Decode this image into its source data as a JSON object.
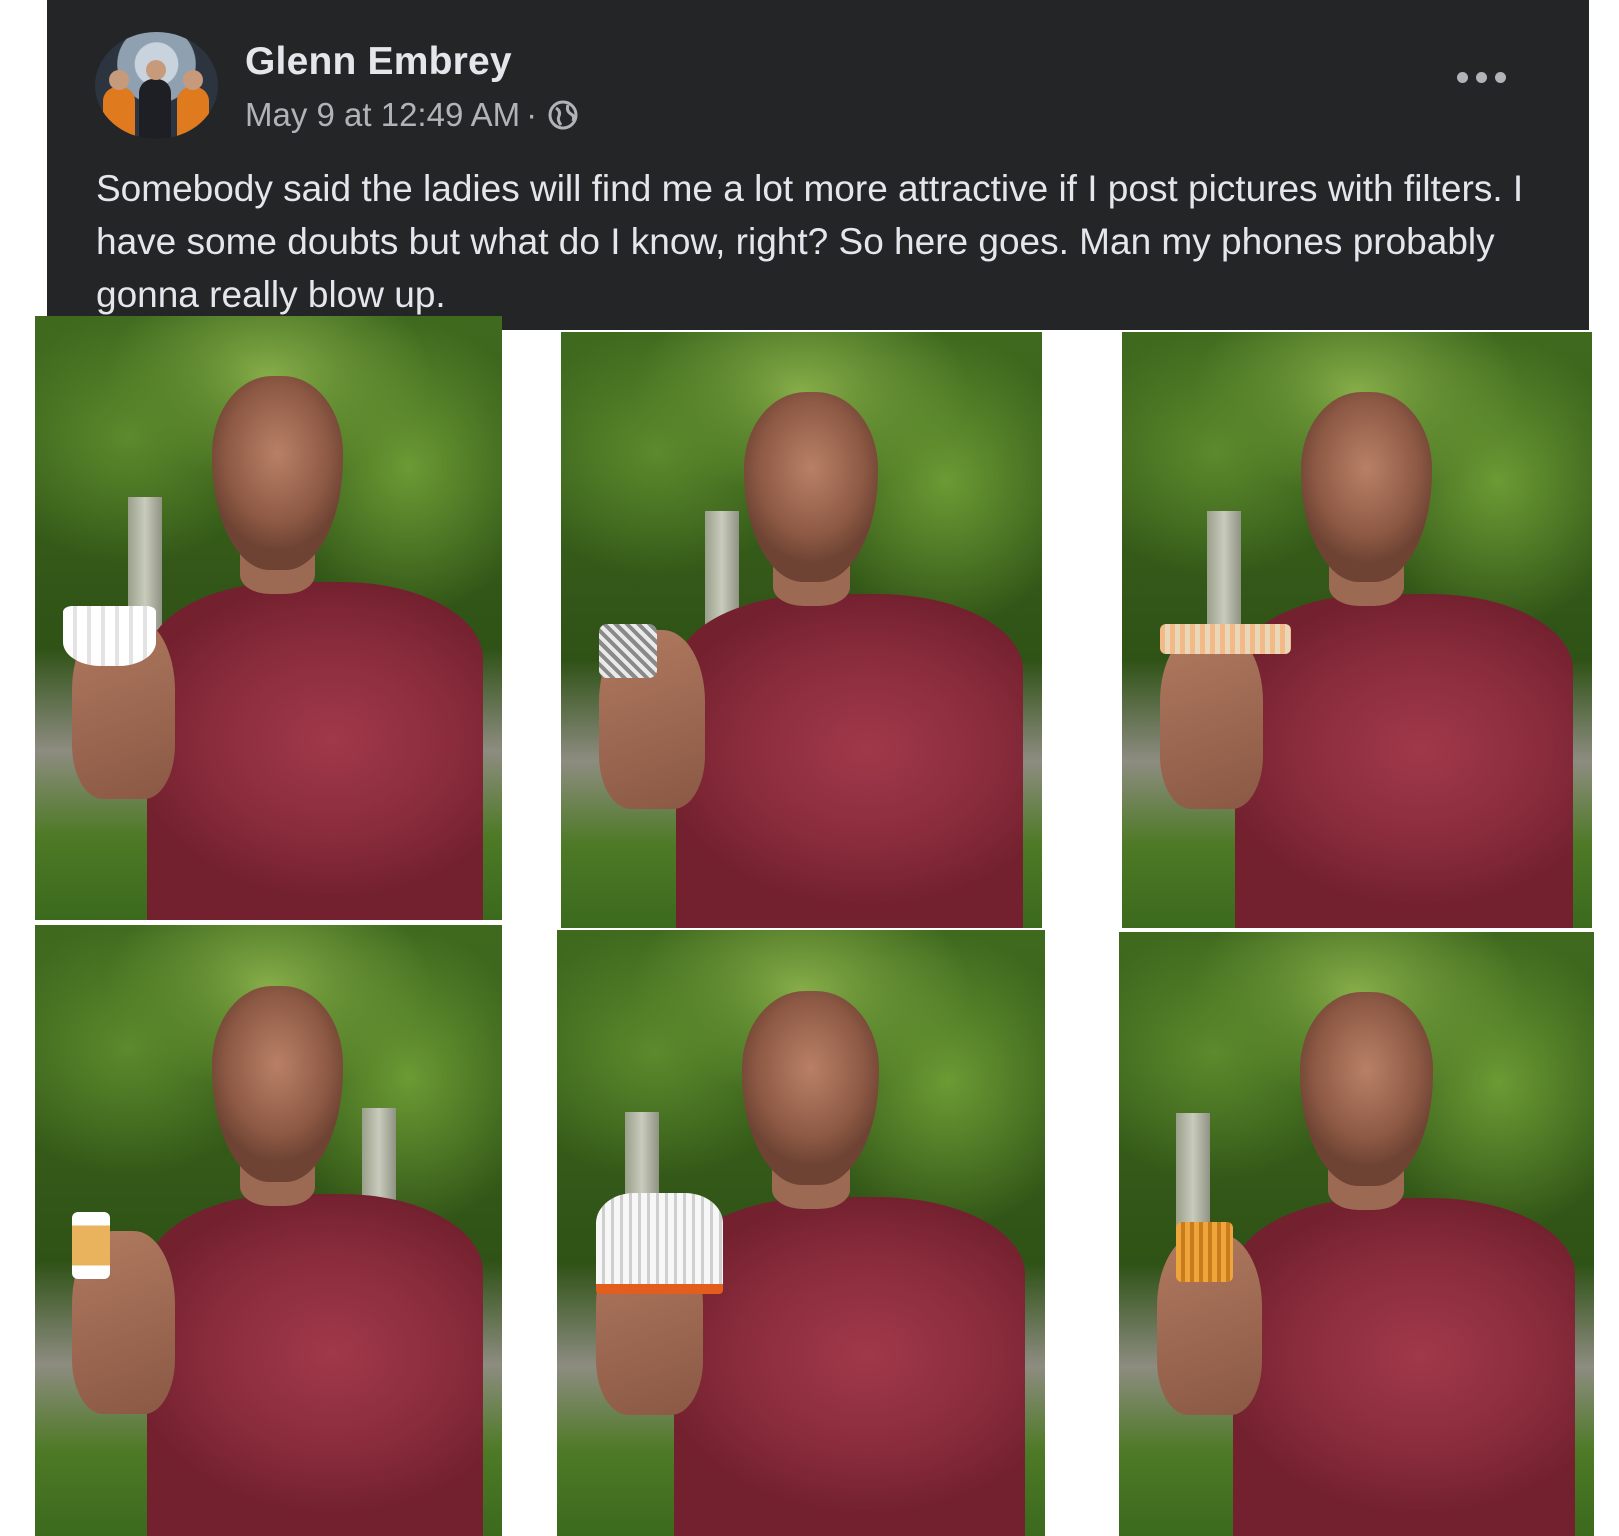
{
  "post": {
    "author": "Glenn Embrey",
    "timestamp": "May 9 at 12:49 AM",
    "separator": "·",
    "privacy_icon": "globe-icon",
    "more_icon": "more-options-icon",
    "caption": "Somebody said the ladies will find me a lot more attractive if I post pictures with filters. I have some doubts but what do I know, right? So here goes. Man my phones probably gonna really blow up."
  },
  "colors": {
    "post_background": "#242526",
    "primary_text": "#e4e6eb",
    "secondary_text": "#b0b3b8",
    "shirt": "#8a2c3c"
  },
  "photos": [
    {
      "filter": "coffee-filter"
    },
    {
      "filter": "mesh-cup-filter"
    },
    {
      "filter": "round-air-filter"
    },
    {
      "filter": "inline-fuel-filter"
    },
    {
      "filter": "conical-air-filter"
    },
    {
      "filter": "panel-filter"
    }
  ]
}
